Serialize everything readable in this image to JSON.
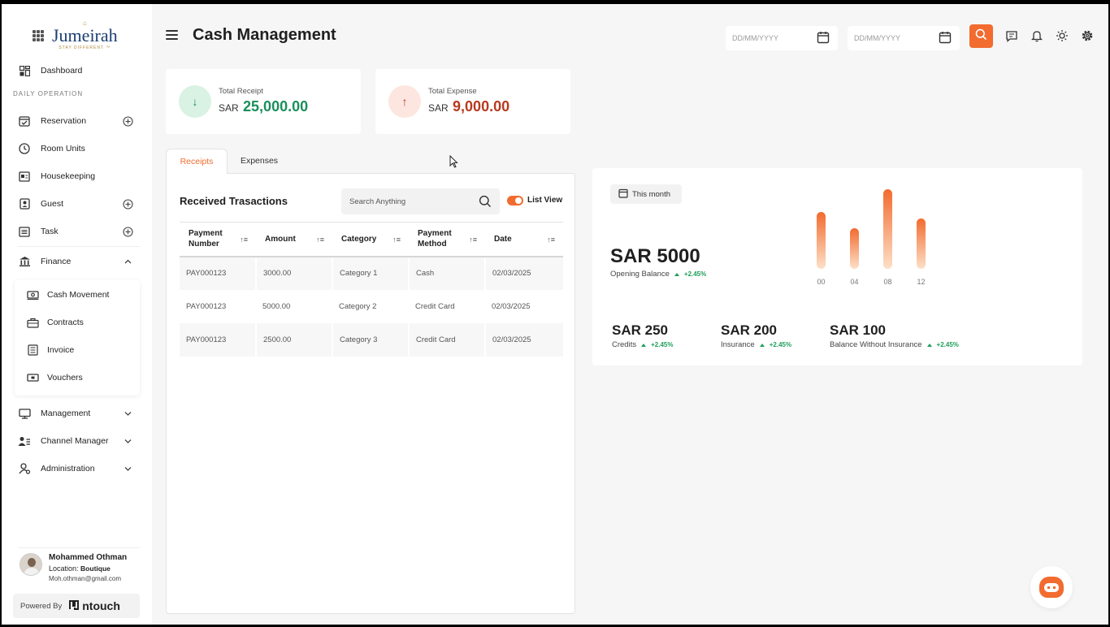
{
  "brand": {
    "logo_mark": "⌂",
    "name": "Jumeirah",
    "tagline": "STAY DIFFERENT ™"
  },
  "sidebar": {
    "dashboard": "Dashboard",
    "section_label": "DAILY OPERATION",
    "items": [
      {
        "label": "Reservation",
        "icon": "calendar-check-icon",
        "trailing": "plus"
      },
      {
        "label": "Room Units",
        "icon": "clock-icon",
        "trailing": ""
      },
      {
        "label": "Housekeeping",
        "icon": "id-card-icon",
        "trailing": ""
      },
      {
        "label": "Guest",
        "icon": "guest-icon",
        "trailing": "plus"
      },
      {
        "label": "Task",
        "icon": "list-icon",
        "trailing": "plus"
      },
      {
        "label": "Finance",
        "icon": "bank-icon",
        "trailing": "chevron-up"
      }
    ],
    "finance_submenu": [
      {
        "label": "Cash Movement",
        "icon": "cash-icon"
      },
      {
        "label": "Contracts",
        "icon": "briefcase-icon"
      },
      {
        "label": "Invoice",
        "icon": "invoice-icon"
      },
      {
        "label": "Vouchers",
        "icon": "voucher-icon"
      }
    ],
    "lower_items": [
      {
        "label": "Management",
        "icon": "monitor-icon"
      },
      {
        "label": "Channel Manager",
        "icon": "users-icon"
      },
      {
        "label": "Administration",
        "icon": "admin-icon"
      }
    ],
    "user": {
      "name": "Mohammed Othman",
      "location_label": "Location:",
      "location": "Boutique",
      "email": "Moh.othman@gmail.com"
    },
    "powered_by": "Powered By",
    "powered_brand": "ntouch"
  },
  "header": {
    "title": "Cash Management",
    "date_from_placeholder": "DD/MM/YYYY",
    "date_to_placeholder": "DD/MM/YYYY"
  },
  "summary": {
    "receipt": {
      "label": "Total Receipt",
      "currency": "SAR",
      "value": "25,000.00",
      "color": "#1a8f5a"
    },
    "expense": {
      "label": "Total Expense",
      "currency": "SAR",
      "value": "9,000.00",
      "color": "#b83a1e"
    }
  },
  "tabs": {
    "receipts": "Receipts",
    "expenses": "Expenses"
  },
  "transactions": {
    "title": "Received Trasactions",
    "search_placeholder": "Search Anything",
    "list_view_label": "List View",
    "columns": [
      {
        "line1": "Payment",
        "line2": "Number"
      },
      {
        "line1": "Amount",
        "line2": ""
      },
      {
        "line1": "Category",
        "line2": ""
      },
      {
        "line1": "Payment",
        "line2": "Method"
      },
      {
        "line1": "Date",
        "line2": ""
      }
    ],
    "rows": [
      {
        "number": "PAY000123",
        "amount": "3000.00",
        "category": "Category 1",
        "method": "Cash",
        "date": "02/03/2025"
      },
      {
        "number": "PAY000123",
        "amount": "5000.00",
        "category": "Category 2",
        "method": "Credit Card",
        "date": "02/03/2025"
      },
      {
        "number": "PAY000123",
        "amount": "2500.00",
        "category": "Category 3",
        "method": "Credit Card",
        "date": "02/03/2025"
      }
    ]
  },
  "stats": {
    "period": "This month",
    "opening_value": "SAR 5000",
    "opening_label": "Opening Balance",
    "opening_delta": "+2.45%",
    "minis": [
      {
        "value": "SAR 250",
        "label": "Credits",
        "delta": "+2.45%"
      },
      {
        "value": "SAR 200",
        "label": "Insurance",
        "delta": "+2.45%"
      },
      {
        "value": "SAR 100",
        "label": "Balance Without Insurance",
        "delta": "+2.45%"
      }
    ]
  },
  "chart_data": {
    "type": "bar",
    "categories": [
      "00",
      "04",
      "08",
      "12"
    ],
    "values": [
      70,
      50,
      98,
      62
    ],
    "ylim": [
      0,
      100
    ],
    "grid": false,
    "colors": {
      "top": "#f26b2f",
      "bottom": "#fde0c8"
    }
  },
  "colors": {
    "accent": "#f26b2f",
    "positive": "#1e9e5a"
  }
}
